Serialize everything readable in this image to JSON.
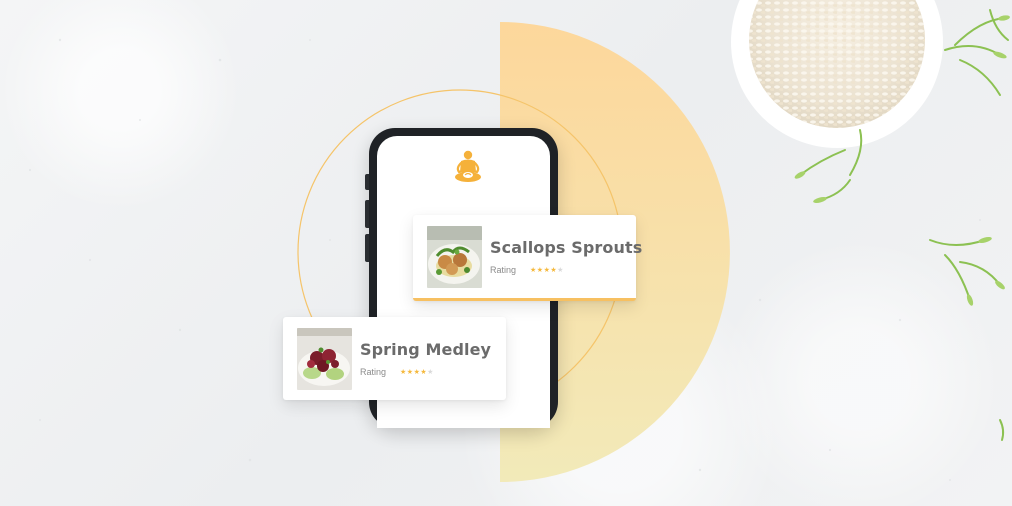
{
  "colors": {
    "accent": "#f7c061",
    "half_circle_top": "#fdd79b",
    "half_circle_bottom": "#f3e7b6",
    "ring": "#f5c46a",
    "card_title": "#6b6b6b",
    "star_on": "#f5b93e",
    "star_off": "#d9d9d9"
  },
  "phone": {
    "logo_icon": "meditating-figure-icon"
  },
  "cards": [
    {
      "title": "Scallops Sprouts",
      "rating_label": "Rating",
      "rating_stars": 4,
      "rating_max": 5,
      "image_icon": "scallops-dish-photo"
    },
    {
      "title": "Spring Medley",
      "rating_label": "Rating",
      "rating_stars": 4,
      "rating_max": 5,
      "image_icon": "salad-dish-photo"
    }
  ]
}
